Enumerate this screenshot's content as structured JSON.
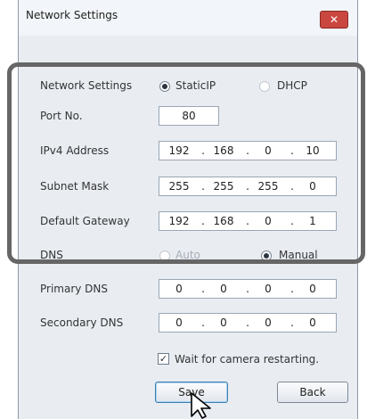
{
  "window": {
    "title": "Network Settings",
    "close_icon": "✕"
  },
  "network_settings": {
    "label": "Network Settings",
    "options": [
      "StaticIP",
      "DHCP"
    ],
    "selected": "StaticIP"
  },
  "port": {
    "label": "Port No.",
    "value": "80"
  },
  "ipv4": {
    "label": "IPv4 Address",
    "octets": [
      "192",
      "168",
      "0",
      "10"
    ]
  },
  "subnet": {
    "label": "Subnet Mask",
    "octets": [
      "255",
      "255",
      "255",
      "0"
    ]
  },
  "gateway": {
    "label": "Default Gateway",
    "octets": [
      "192",
      "168",
      "0",
      "1"
    ]
  },
  "dns": {
    "label": "DNS",
    "options": [
      "Auto",
      "Manual"
    ],
    "selected": "Manual"
  },
  "primary_dns": {
    "label": "Primary DNS",
    "octets": [
      "0",
      "0",
      "0",
      "0"
    ]
  },
  "secondary_dns": {
    "label": "Secondary DNS",
    "octets": [
      "0",
      "0",
      "0",
      "0"
    ]
  },
  "wait": {
    "label": "Wait for camera restarting.",
    "checked": true
  },
  "buttons": {
    "save": "Save",
    "back": "Back"
  },
  "separator": "."
}
